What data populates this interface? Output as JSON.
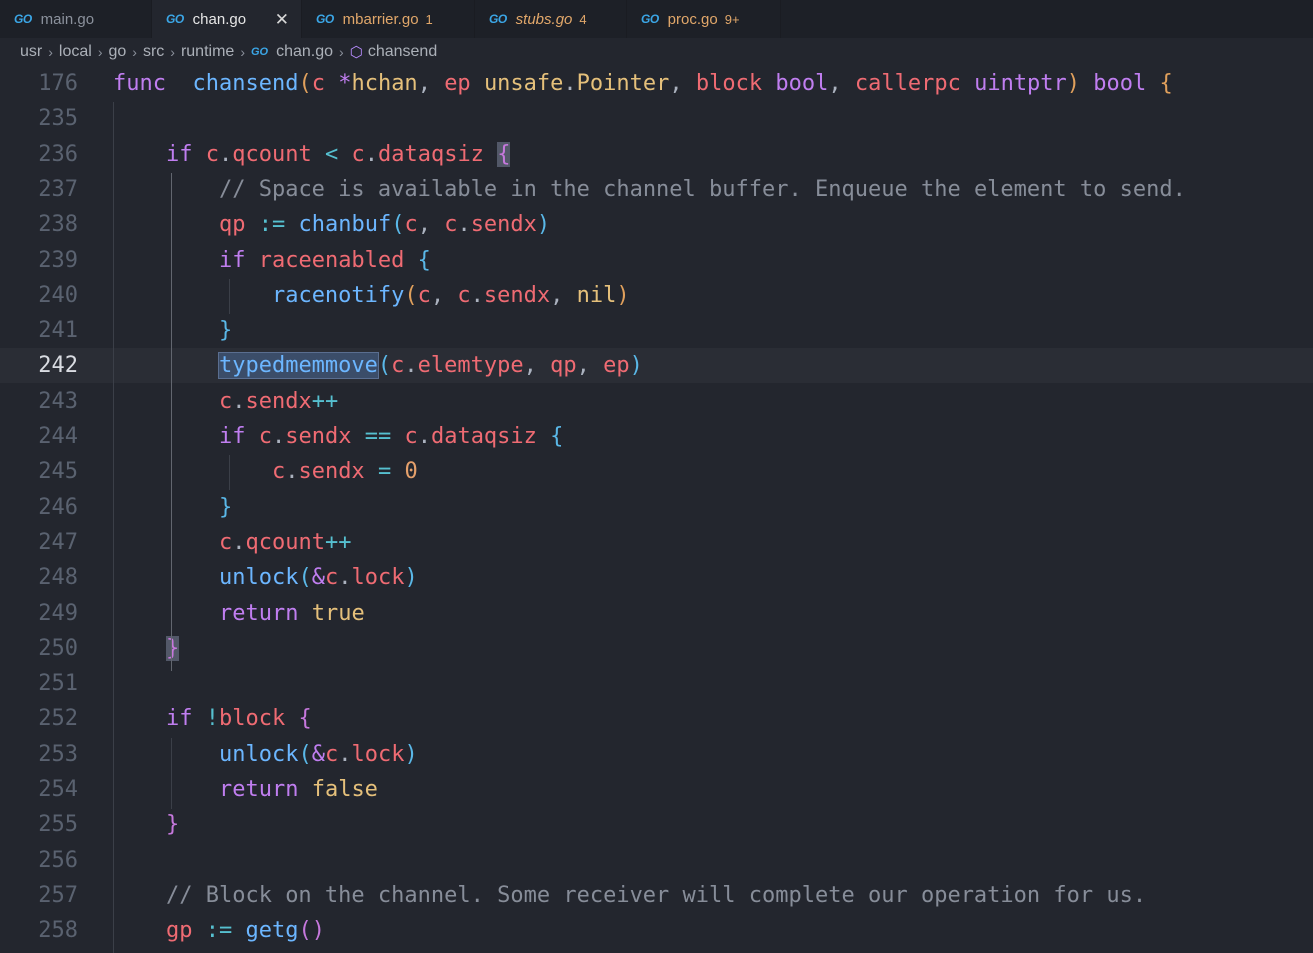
{
  "tabs": [
    {
      "label": "main.go",
      "badge": "",
      "active": false,
      "status": "normal"
    },
    {
      "label": "chan.go",
      "badge": "",
      "active": true,
      "status": "normal"
    },
    {
      "label": "mbarrier.go",
      "badge": "1",
      "active": false,
      "status": "warning"
    },
    {
      "label": "stubs.go",
      "badge": "4",
      "active": false,
      "status": "warning-italic"
    },
    {
      "label": "proc.go",
      "badge": "9+",
      "active": false,
      "status": "warning"
    }
  ],
  "tab_icon": "GO",
  "close_glyph": "✕",
  "breadcrumb": {
    "parts": [
      "usr",
      "local",
      "go",
      "src",
      "runtime"
    ],
    "file": "chan.go",
    "symbol": "chansend",
    "separator": "›"
  },
  "editor": {
    "current_line": "242",
    "lines": [
      {
        "num": "176",
        "tokens": [
          [
            "kw",
            "func"
          ],
          [
            "",
            "  "
          ],
          [
            "fn",
            "chansend"
          ],
          [
            "p1",
            "("
          ],
          [
            "vr",
            "c"
          ],
          [
            "",
            " "
          ],
          [
            "kw",
            "*"
          ],
          [
            "ty",
            "hchan"
          ],
          [
            "pn",
            ", "
          ],
          [
            "vr",
            "ep"
          ],
          [
            "",
            " "
          ],
          [
            "ty",
            "unsafe"
          ],
          [
            "pn",
            "."
          ],
          [
            "ty",
            "Pointer"
          ],
          [
            "pn",
            ", "
          ],
          [
            "vr",
            "block"
          ],
          [
            "",
            " "
          ],
          [
            "kw",
            "bool"
          ],
          [
            "pn",
            ", "
          ],
          [
            "vr",
            "callerpc"
          ],
          [
            "",
            " "
          ],
          [
            "kw",
            "uintptr"
          ],
          [
            "p1",
            ")"
          ],
          [
            "",
            " "
          ],
          [
            "kw",
            "bool"
          ],
          [
            "",
            " "
          ],
          [
            "p1",
            "{"
          ]
        ]
      },
      {
        "num": "235",
        "tokens": []
      },
      {
        "num": "236",
        "tokens": [
          [
            "",
            "    "
          ],
          [
            "kw",
            "if"
          ],
          [
            "",
            " "
          ],
          [
            "vr",
            "c"
          ],
          [
            "pn",
            "."
          ],
          [
            "vr",
            "qcount"
          ],
          [
            "",
            " "
          ],
          [
            "op",
            "<"
          ],
          [
            "",
            " "
          ],
          [
            "vr",
            "c"
          ],
          [
            "pn",
            "."
          ],
          [
            "vr",
            "dataqsiz"
          ],
          [
            "",
            " "
          ],
          [
            "p2 bm",
            "{"
          ]
        ]
      },
      {
        "num": "237",
        "tokens": [
          [
            "",
            "        "
          ],
          [
            "cm",
            "// Space is available in the channel buffer. Enqueue the element to send."
          ]
        ]
      },
      {
        "num": "238",
        "tokens": [
          [
            "",
            "        "
          ],
          [
            "vr",
            "qp"
          ],
          [
            "",
            " "
          ],
          [
            "op",
            ":="
          ],
          [
            "",
            " "
          ],
          [
            "fn",
            "chanbuf"
          ],
          [
            "p3",
            "("
          ],
          [
            "vr",
            "c"
          ],
          [
            "pn",
            ", "
          ],
          [
            "vr",
            "c"
          ],
          [
            "pn",
            "."
          ],
          [
            "vr",
            "sendx"
          ],
          [
            "p3",
            ")"
          ]
        ]
      },
      {
        "num": "239",
        "tokens": [
          [
            "",
            "        "
          ],
          [
            "kw",
            "if"
          ],
          [
            "",
            " "
          ],
          [
            "vr",
            "raceenabled"
          ],
          [
            "",
            " "
          ],
          [
            "p3",
            "{"
          ]
        ]
      },
      {
        "num": "240",
        "tokens": [
          [
            "",
            "            "
          ],
          [
            "fn",
            "racenotify"
          ],
          [
            "p1",
            "("
          ],
          [
            "vr",
            "c"
          ],
          [
            "pn",
            ", "
          ],
          [
            "vr",
            "c"
          ],
          [
            "pn",
            "."
          ],
          [
            "vr",
            "sendx"
          ],
          [
            "pn",
            ", "
          ],
          [
            "bool",
            "nil"
          ],
          [
            "p1",
            ")"
          ]
        ]
      },
      {
        "num": "241",
        "tokens": [
          [
            "",
            "        "
          ],
          [
            "p3",
            "}"
          ]
        ]
      },
      {
        "num": "242",
        "tokens": [
          [
            "",
            "        "
          ],
          [
            "fn hl",
            "typedmemmove"
          ],
          [
            "p3",
            "("
          ],
          [
            "vr",
            "c"
          ],
          [
            "pn",
            "."
          ],
          [
            "vr",
            "elemtype"
          ],
          [
            "pn",
            ", "
          ],
          [
            "vr",
            "qp"
          ],
          [
            "pn",
            ", "
          ],
          [
            "vr",
            "ep"
          ],
          [
            "p3",
            ")"
          ]
        ]
      },
      {
        "num": "243",
        "tokens": [
          [
            "",
            "        "
          ],
          [
            "vr",
            "c"
          ],
          [
            "pn",
            "."
          ],
          [
            "vr",
            "sendx"
          ],
          [
            "op",
            "++"
          ]
        ]
      },
      {
        "num": "244",
        "tokens": [
          [
            "",
            "        "
          ],
          [
            "kw",
            "if"
          ],
          [
            "",
            " "
          ],
          [
            "vr",
            "c"
          ],
          [
            "pn",
            "."
          ],
          [
            "vr",
            "sendx"
          ],
          [
            "",
            " "
          ],
          [
            "op",
            "=="
          ],
          [
            "",
            " "
          ],
          [
            "vr",
            "c"
          ],
          [
            "pn",
            "."
          ],
          [
            "vr",
            "dataqsiz"
          ],
          [
            "",
            " "
          ],
          [
            "p3",
            "{"
          ]
        ]
      },
      {
        "num": "245",
        "tokens": [
          [
            "",
            "            "
          ],
          [
            "vr",
            "c"
          ],
          [
            "pn",
            "."
          ],
          [
            "vr",
            "sendx"
          ],
          [
            "",
            " "
          ],
          [
            "op",
            "="
          ],
          [
            "",
            " "
          ],
          [
            "num",
            "0"
          ]
        ]
      },
      {
        "num": "246",
        "tokens": [
          [
            "",
            "        "
          ],
          [
            "p3",
            "}"
          ]
        ]
      },
      {
        "num": "247",
        "tokens": [
          [
            "",
            "        "
          ],
          [
            "vr",
            "c"
          ],
          [
            "pn",
            "."
          ],
          [
            "vr",
            "qcount"
          ],
          [
            "op",
            "++"
          ]
        ]
      },
      {
        "num": "248",
        "tokens": [
          [
            "",
            "        "
          ],
          [
            "fn",
            "unlock"
          ],
          [
            "p3",
            "("
          ],
          [
            "kw",
            "&"
          ],
          [
            "vr",
            "c"
          ],
          [
            "pn",
            "."
          ],
          [
            "vr",
            "lock"
          ],
          [
            "p3",
            ")"
          ]
        ]
      },
      {
        "num": "249",
        "tokens": [
          [
            "",
            "        "
          ],
          [
            "kw",
            "return"
          ],
          [
            "",
            " "
          ],
          [
            "bool",
            "true"
          ]
        ]
      },
      {
        "num": "250",
        "tokens": [
          [
            "",
            "    "
          ],
          [
            "p2 bm",
            "}"
          ]
        ]
      },
      {
        "num": "251",
        "tokens": []
      },
      {
        "num": "252",
        "tokens": [
          [
            "",
            "    "
          ],
          [
            "kw",
            "if"
          ],
          [
            "",
            " "
          ],
          [
            "op",
            "!"
          ],
          [
            "vr",
            "block"
          ],
          [
            "",
            " "
          ],
          [
            "p2",
            "{"
          ]
        ]
      },
      {
        "num": "253",
        "tokens": [
          [
            "",
            "        "
          ],
          [
            "fn",
            "unlock"
          ],
          [
            "p3",
            "("
          ],
          [
            "kw",
            "&"
          ],
          [
            "vr",
            "c"
          ],
          [
            "pn",
            "."
          ],
          [
            "vr",
            "lock"
          ],
          [
            "p3",
            ")"
          ]
        ]
      },
      {
        "num": "254",
        "tokens": [
          [
            "",
            "        "
          ],
          [
            "kw",
            "return"
          ],
          [
            "",
            " "
          ],
          [
            "bool",
            "false"
          ]
        ]
      },
      {
        "num": "255",
        "tokens": [
          [
            "",
            "    "
          ],
          [
            "p2",
            "}"
          ]
        ]
      },
      {
        "num": "256",
        "tokens": []
      },
      {
        "num": "257",
        "tokens": [
          [
            "",
            "    "
          ],
          [
            "cm",
            "// Block on the channel. Some receiver will complete our operation for us."
          ]
        ]
      },
      {
        "num": "258",
        "tokens": [
          [
            "",
            "    "
          ],
          [
            "vr",
            "gp"
          ],
          [
            "",
            " "
          ],
          [
            "op",
            ":="
          ],
          [
            "",
            " "
          ],
          [
            "fn",
            "getg"
          ],
          [
            "p2",
            "()"
          ]
        ]
      }
    ]
  }
}
